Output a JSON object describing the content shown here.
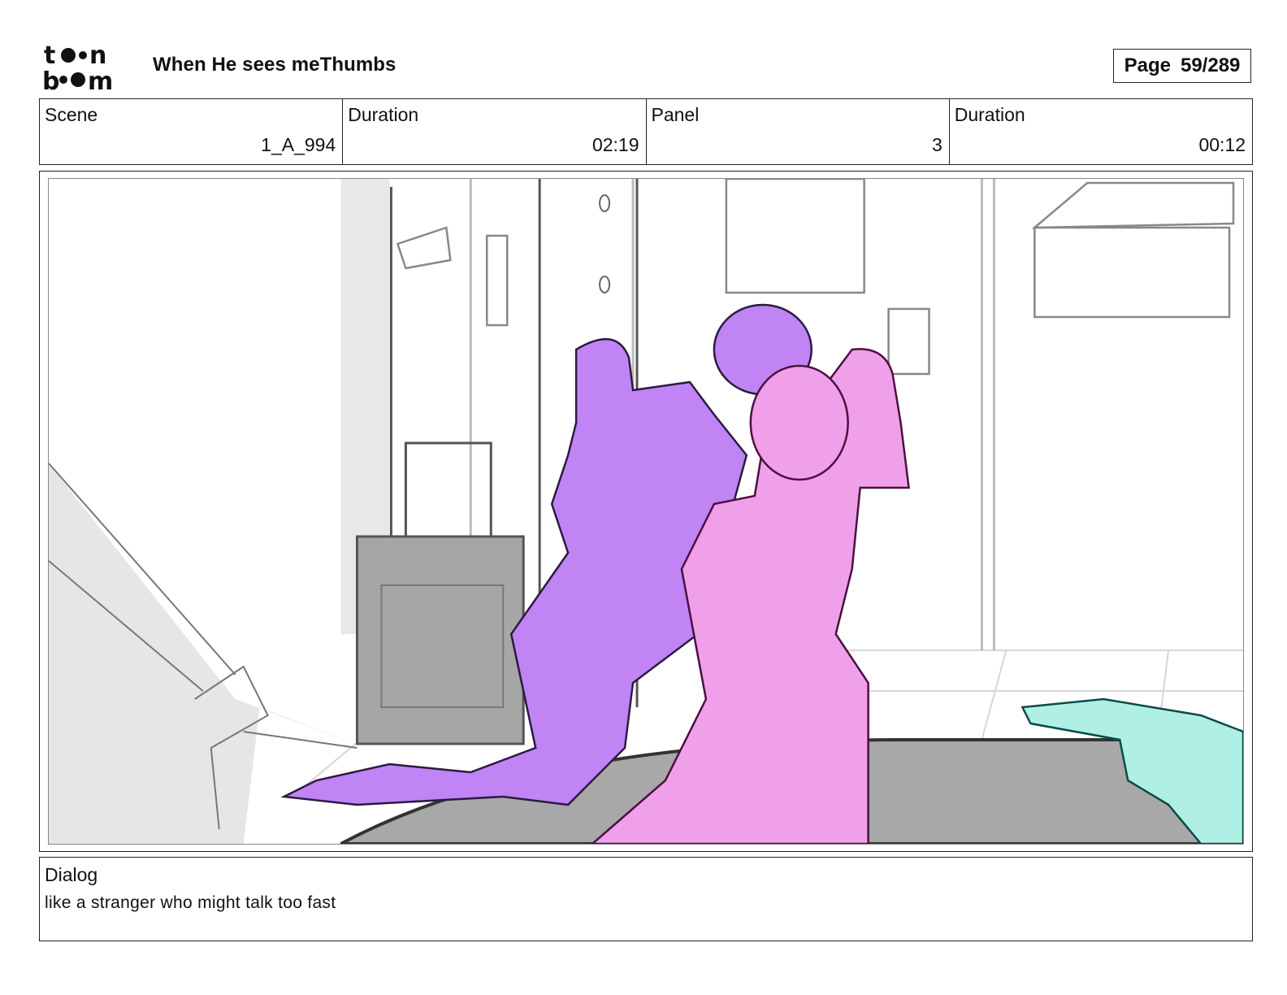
{
  "header": {
    "logo_text_top": "to•n",
    "logo_text_bottom": "b••m",
    "title": "When He sees meThumbs",
    "page_label": "Page",
    "page_value": "59/289"
  },
  "info": {
    "scene_label": "Scene",
    "scene_value": "1_A_994",
    "scene_duration_label": "Duration",
    "scene_duration_value": "02:19",
    "panel_label": "Panel",
    "panel_value": "3",
    "panel_duration_label": "Duration",
    "panel_duration_value": "00:12"
  },
  "dialog": {
    "label": "Dialog",
    "text": "like a stranger who might talk too fast"
  },
  "colors": {
    "purple_character": "#c084f5",
    "pink_character": "#f0a0e8",
    "teal_character": "#b0f0e4",
    "gray_shadow": "#d8d8d8",
    "rug": "#a8a8a8"
  }
}
